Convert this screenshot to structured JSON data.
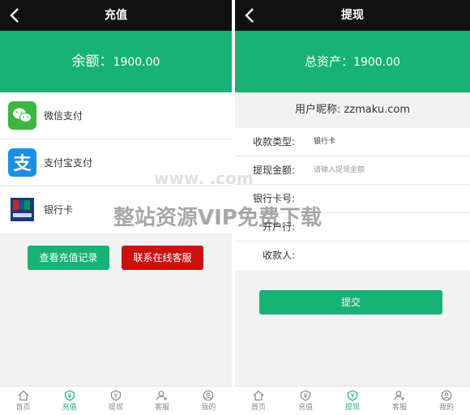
{
  "left": {
    "title": "充值",
    "balance_label": "余额：",
    "balance_value": "1900.00",
    "pay_methods": [
      {
        "label": "微信支付",
        "icon": "wechat-pay-icon",
        "color": "#3fb542"
      },
      {
        "label": "支付宝支付",
        "icon": "alipay-icon",
        "color": "#1a8fe3"
      },
      {
        "label": "银行卡",
        "icon": "unionpay-card-icon",
        "color": "#1c3a78"
      }
    ],
    "records_button": "查看充值记录",
    "service_button": "联系在线客服"
  },
  "right": {
    "title": "提现",
    "assets_label": "总资产：",
    "assets_value": "1900.00",
    "nickname_label": "用户昵称:",
    "nickname_value": "zzmaku.com",
    "fields": {
      "type_label": "收款类型:",
      "type_value": "银行卡",
      "amount_label": "提现金额:",
      "amount_placeholder": "请输入提现金额",
      "card_label": "银行卡号:",
      "bank_label": "开户行:",
      "payee_label": "收款人:"
    },
    "submit_button": "提交"
  },
  "tabs": [
    "首页",
    "充值",
    "提现",
    "客服",
    "我的"
  ],
  "watermark": {
    "url": "www.      .com",
    "text": "整站资源VIP免费下载"
  },
  "colors": {
    "accent": "#17b374",
    "danger": "#cc1111",
    "header": "#111111"
  }
}
